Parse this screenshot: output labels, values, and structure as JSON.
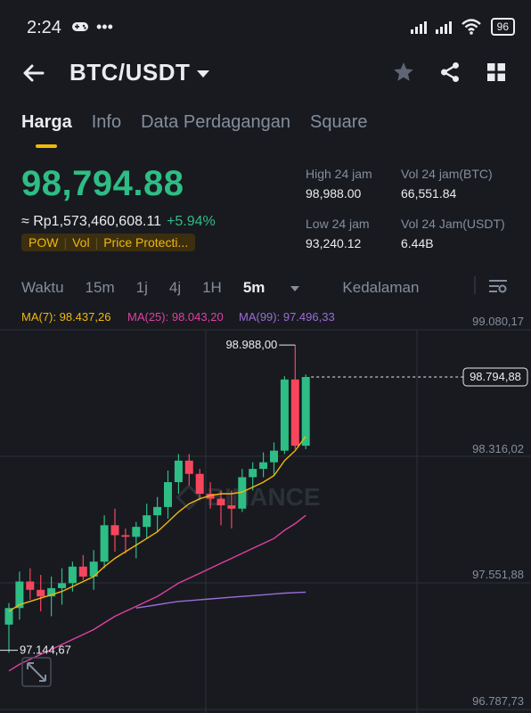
{
  "status_bar": {
    "time": "2:24",
    "battery": "96"
  },
  "header": {
    "pair": "BTC/USDT"
  },
  "tabs": [
    {
      "label": "Harga",
      "active": true
    },
    {
      "label": "Info",
      "active": false
    },
    {
      "label": "Data Perdagangan",
      "active": false
    },
    {
      "label": "Square",
      "active": false
    }
  ],
  "ticker": {
    "last_price": "98,794.88",
    "fiat_value": "≈ Rp1,573,460,608.11",
    "change_pct": "+5.94%",
    "tags": [
      "POW",
      "Vol",
      "Price Protecti..."
    ],
    "high_label": "High 24 jam",
    "high_value": "98,988.00",
    "low_label": "Low 24 jam",
    "low_value": "93,240.12",
    "vol_base_label": "Vol 24 jam(BTC)",
    "vol_base_value": "66,551.84",
    "vol_quote_label": "Vol 24 Jam(USDT)",
    "vol_quote_value": "6.44B"
  },
  "intervals": {
    "items": [
      "Waktu",
      "15m",
      "1j",
      "4j",
      "1H"
    ],
    "selected": "5m",
    "depth": "Kedalaman"
  },
  "chart": {
    "ma7": "MA(7): 98.437,26",
    "ma25": "MA(25): 98.043,20",
    "ma99": "MA(99): 97.496,33",
    "axis": [
      "99.080,17",
      "98.316,02",
      "97.551,88",
      "96.787,73"
    ],
    "high_marker": "98.988,00",
    "low_marker": "97.144,67",
    "current_price": "98.794,88",
    "watermark": "BINANCE",
    "colors": {
      "up": "#2ebd85",
      "down": "#f6465d",
      "ma7": "#f0b90b",
      "ma25": "#e040a0",
      "ma99": "#9c6cd8"
    }
  },
  "chart_data": {
    "type": "candlestick",
    "ylim": [
      96787.73,
      99080.17
    ],
    "candles": [
      {
        "o": 97300,
        "h": 97430,
        "l": 97130,
        "c": 97400
      },
      {
        "o": 97400,
        "h": 97620,
        "l": 97330,
        "c": 97560
      },
      {
        "o": 97560,
        "h": 97640,
        "l": 97450,
        "c": 97510
      },
      {
        "o": 97510,
        "h": 97600,
        "l": 97380,
        "c": 97470
      },
      {
        "o": 97470,
        "h": 97590,
        "l": 97350,
        "c": 97520
      },
      {
        "o": 97520,
        "h": 97640,
        "l": 97420,
        "c": 97550
      },
      {
        "o": 97550,
        "h": 97680,
        "l": 97500,
        "c": 97650
      },
      {
        "o": 97650,
        "h": 97720,
        "l": 97570,
        "c": 97590
      },
      {
        "o": 97590,
        "h": 97750,
        "l": 97510,
        "c": 97680
      },
      {
        "o": 97680,
        "h": 97960,
        "l": 97640,
        "c": 97900
      },
      {
        "o": 97900,
        "h": 98000,
        "l": 97740,
        "c": 97840
      },
      {
        "o": 97840,
        "h": 97880,
        "l": 97730,
        "c": 97830
      },
      {
        "o": 97830,
        "h": 97920,
        "l": 97700,
        "c": 97890
      },
      {
        "o": 97890,
        "h": 98030,
        "l": 97820,
        "c": 97960
      },
      {
        "o": 97960,
        "h": 98070,
        "l": 97860,
        "c": 98010
      },
      {
        "o": 98010,
        "h": 98230,
        "l": 97940,
        "c": 98160
      },
      {
        "o": 98160,
        "h": 98330,
        "l": 98090,
        "c": 98290
      },
      {
        "o": 98290,
        "h": 98330,
        "l": 98140,
        "c": 98210
      },
      {
        "o": 98210,
        "h": 98240,
        "l": 98050,
        "c": 98090
      },
      {
        "o": 98090,
        "h": 98160,
        "l": 98000,
        "c": 98060
      },
      {
        "o": 98060,
        "h": 98110,
        "l": 97900,
        "c": 98020
      },
      {
        "o": 98020,
        "h": 98110,
        "l": 97880,
        "c": 98000
      },
      {
        "o": 98000,
        "h": 98240,
        "l": 97980,
        "c": 98190
      },
      {
        "o": 98190,
        "h": 98280,
        "l": 98110,
        "c": 98240
      },
      {
        "o": 98240,
        "h": 98340,
        "l": 98190,
        "c": 98280
      },
      {
        "o": 98280,
        "h": 98400,
        "l": 98200,
        "c": 98350
      },
      {
        "o": 98350,
        "h": 98800,
        "l": 98330,
        "c": 98780
      },
      {
        "o": 98780,
        "h": 98988,
        "l": 98360,
        "c": 98380
      },
      {
        "o": 98380,
        "h": 98810,
        "l": 98360,
        "c": 98795
      }
    ],
    "ma7": [
      97380,
      97420,
      97440,
      97460,
      97480,
      97500,
      97530,
      97560,
      97590,
      97650,
      97700,
      97740,
      97780,
      97820,
      97860,
      97920,
      97980,
      98030,
      98060,
      98080,
      98090,
      98090,
      98100,
      98130,
      98160,
      98200,
      98290,
      98350,
      98437
    ],
    "ma25": [
      97020,
      97060,
      97090,
      97120,
      97150,
      97180,
      97210,
      97240,
      97270,
      97310,
      97350,
      97380,
      97410,
      97440,
      97470,
      97510,
      97550,
      97580,
      97610,
      97640,
      97670,
      97700,
      97730,
      97760,
      97790,
      97820,
      97870,
      97910,
      97960
    ],
    "ma99": [
      null,
      null,
      null,
      null,
      null,
      null,
      null,
      null,
      null,
      null,
      null,
      null,
      97400,
      97410,
      97420,
      97430,
      97440,
      97445,
      97450,
      97455,
      97460,
      97465,
      97470,
      97475,
      97480,
      97485,
      97490,
      97493,
      97496
    ]
  }
}
